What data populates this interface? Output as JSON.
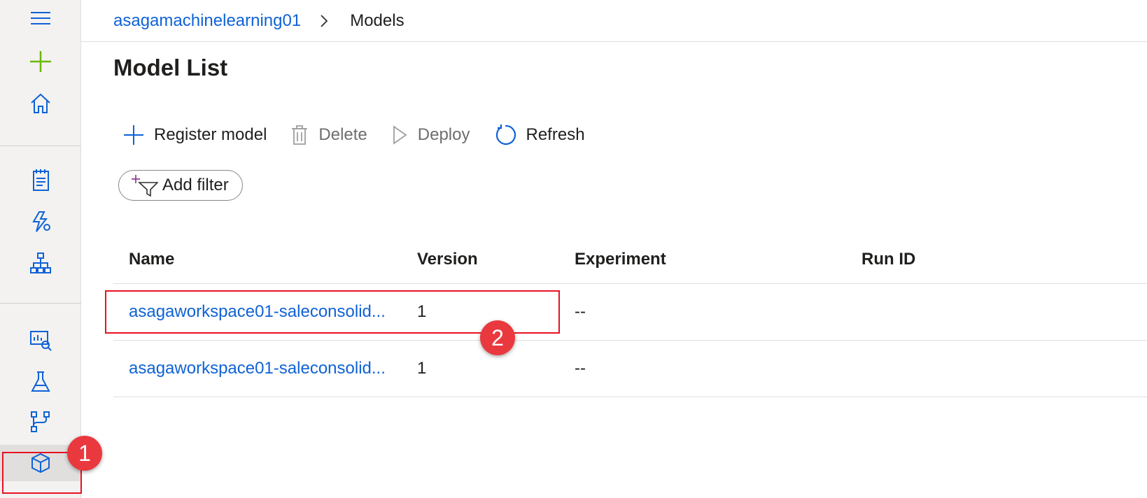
{
  "breadcrumb": {
    "workspace": "asagamachinelearning01",
    "current": "Models"
  },
  "page": {
    "title": "Model List"
  },
  "toolbar": {
    "register_label": "Register model",
    "delete_label": "Delete",
    "deploy_label": "Deploy",
    "refresh_label": "Refresh"
  },
  "filter": {
    "label": "Add filter"
  },
  "table": {
    "columns": [
      "Name",
      "Version",
      "Experiment",
      "Run ID"
    ],
    "rows": [
      {
        "name": "asagaworkspace01-saleconsolid...",
        "version": "1",
        "experiment": "--",
        "run_id": ""
      },
      {
        "name": "asagaworkspace01-saleconsolid...",
        "version": "1",
        "experiment": "--",
        "run_id": ""
      }
    ]
  },
  "annotations": {
    "badge1": "1",
    "badge2": "2"
  },
  "colors": {
    "accent": "#0f62d6",
    "highlight": "#e81123",
    "badge": "#e9393f",
    "new_button": "#6bb700"
  },
  "icons": {
    "rail": [
      "menu-icon",
      "plus-icon",
      "home-icon",
      "notebook-icon",
      "automl-icon",
      "designer-icon",
      "datasets-icon",
      "experiments-icon",
      "pipelines-icon",
      "models-icon"
    ],
    "toolbar": [
      "add-icon",
      "trash-icon",
      "play-icon",
      "refresh-icon"
    ],
    "filter": "filter-add-icon"
  }
}
